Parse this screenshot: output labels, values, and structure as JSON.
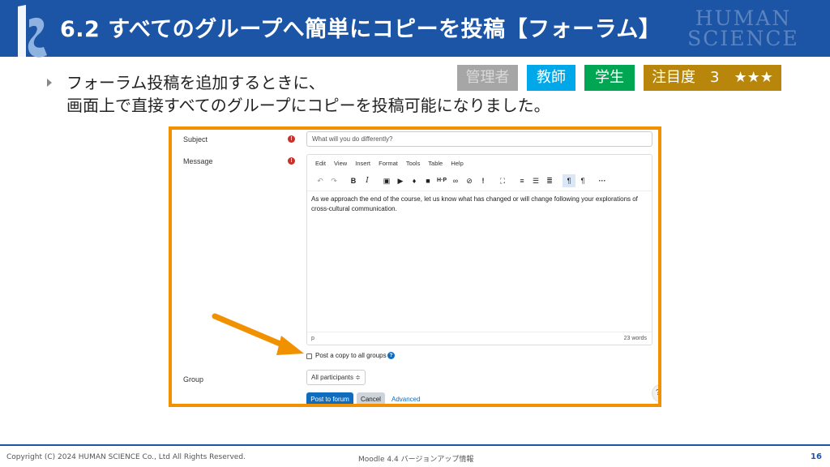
{
  "header": {
    "title": "6.2 すべてのグループへ簡単にコピーを投稿【フォーラム】",
    "brand_line1": "HUMAN",
    "brand_line2": "SCIENCE"
  },
  "bullet": {
    "line1": "フォーラム投稿を追加するときに、",
    "line2": "画面上で直接すべてのグループにコピーを投稿可能になりました。"
  },
  "badges": {
    "admin": "管理者",
    "teacher": "教師",
    "student": "学生",
    "attention": "注目度　3　★★★"
  },
  "form": {
    "subject_label": "Subject",
    "subject_value": "What will you do differently?",
    "message_label": "Message",
    "menu": [
      "Edit",
      "View",
      "Insert",
      "Format",
      "Tools",
      "Table",
      "Help"
    ],
    "message_text": "As we approach the end of the course, let us know what has changed or will change following your explorations of cross-cultural communication.",
    "status_path": "p",
    "word_count": "23 words",
    "copy_checkbox_label": "Post a copy to all groups",
    "group_label": "Group",
    "group_value": "All participants ≑",
    "post_button": "Post to forum",
    "cancel_button": "Cancel",
    "advanced_link": "Advanced"
  },
  "colors": {
    "header_blue": "#1c55a6",
    "frame_orange": "#f29100",
    "admin_grey": "#a6a6a6",
    "teacher_blue": "#00a8ea",
    "student_green": "#00a651",
    "attention_gold": "#b8860b",
    "moodle_blue": "#0f6cbf"
  },
  "footer": {
    "copyright": "Copyright (C) 2024 HUMAN SCIENCE Co., Ltd All Rights Reserved.",
    "doc_title": "Moodle 4.4 バージョンアップ情報",
    "page": "16"
  }
}
